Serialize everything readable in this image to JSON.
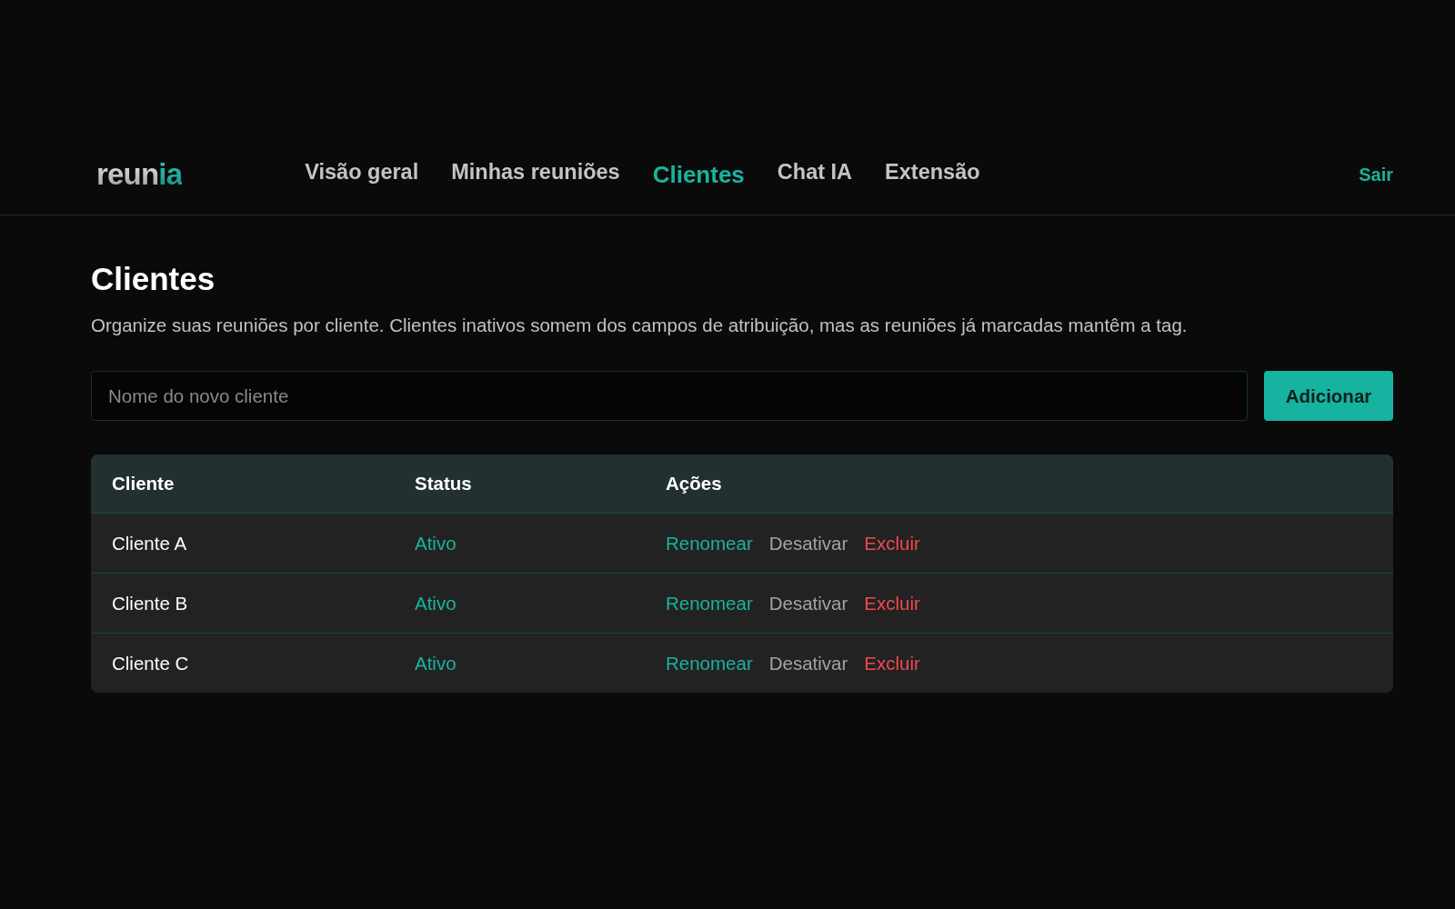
{
  "header": {
    "logo": {
      "parts": [
        {
          "text": "reun",
          "kind": "base"
        },
        {
          "text": "ia",
          "kind": "accent"
        }
      ]
    },
    "nav": [
      {
        "label": "Visão geral",
        "selected": false
      },
      {
        "label": "Minhas reuniões",
        "selected": false
      },
      {
        "label": "Clientes",
        "selected": true
      },
      {
        "label": "Chat IA",
        "selected": false
      },
      {
        "label": "Extensão",
        "selected": false
      }
    ],
    "logout": "Sair"
  },
  "page": {
    "title": "Clientes",
    "description": "Organize suas reuniões por cliente. Clientes inativos somem dos campos de atribuição, mas as reuniões já marcadas mantêm a tag.",
    "new_client": {
      "placeholder": "Nome do novo cliente"
    },
    "add_button": "Adicionar"
  },
  "table": {
    "columns": [
      "Cliente",
      "Status",
      "Ações"
    ],
    "rows": [
      {
        "name": "Cliente A",
        "status": "Ativo",
        "active": true,
        "actions": [
          {
            "label": "Renomear",
            "kind": "rename"
          },
          {
            "label": "Desativar",
            "kind": "toggle"
          },
          {
            "label": "Excluir",
            "kind": "delete"
          }
        ]
      },
      {
        "name": "Cliente B",
        "status": "Ativo",
        "active": true,
        "actions": [
          {
            "label": "Renomear",
            "kind": "rename"
          },
          {
            "label": "Desativar",
            "kind": "toggle"
          },
          {
            "label": "Excluir",
            "kind": "delete"
          }
        ]
      },
      {
        "name": "Cliente C",
        "status": "Ativo",
        "active": true,
        "actions": [
          {
            "label": "Renomear",
            "kind": "rename"
          },
          {
            "label": "Desativar",
            "kind": "toggle"
          },
          {
            "label": "Excluir",
            "kind": "delete"
          }
        ]
      }
    ]
  }
}
